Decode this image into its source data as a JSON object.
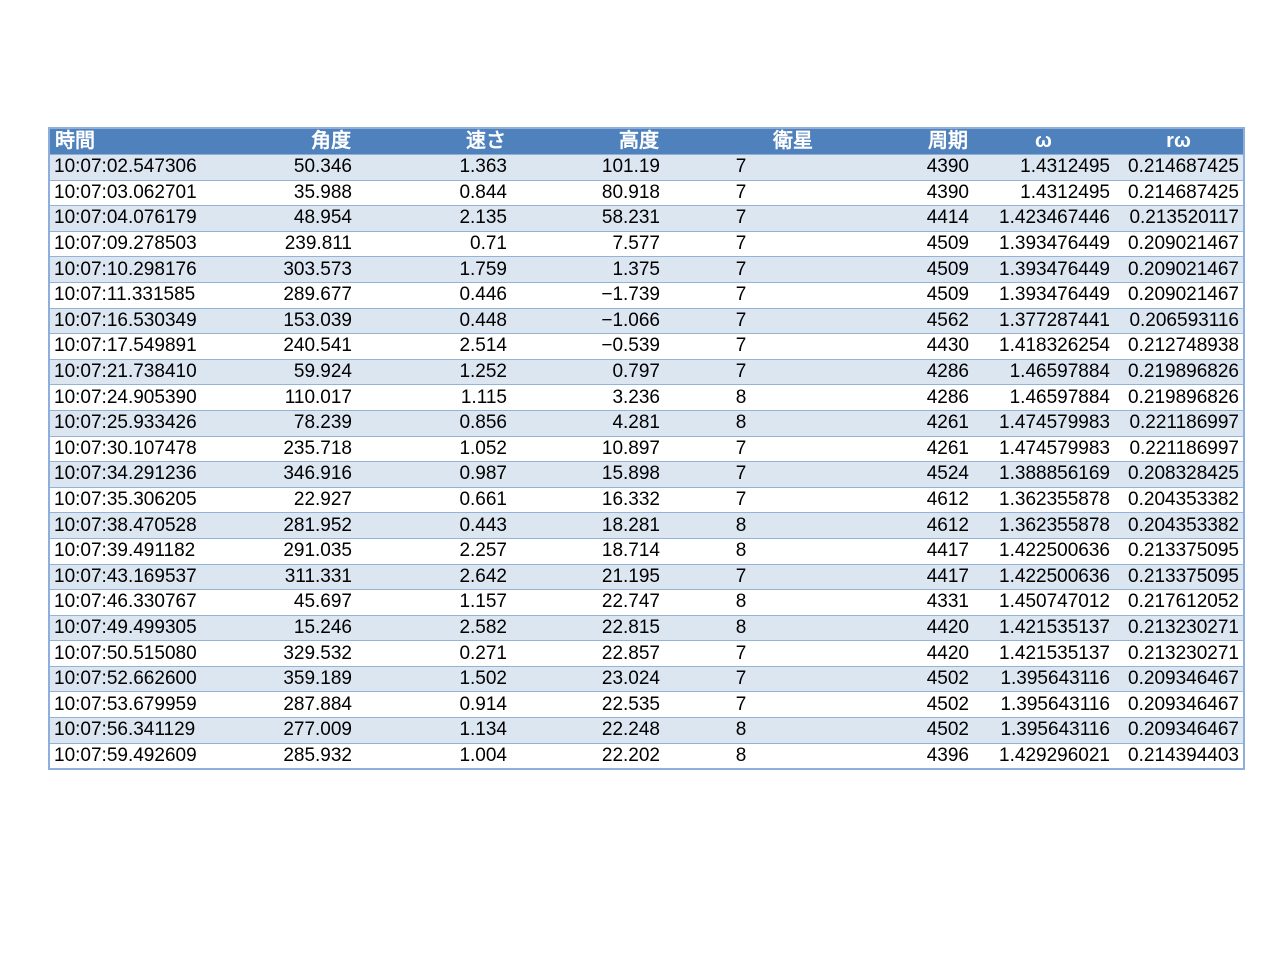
{
  "table": {
    "headers": [
      "時間",
      "角度",
      "速さ",
      "高度",
      "衛星",
      "周期",
      "ω",
      "rω"
    ],
    "rows": [
      [
        "10:07:02.547306",
        "50.346",
        "1.363",
        "101.19",
        "7",
        "4390",
        "1.4312495",
        "0.214687425"
      ],
      [
        "10:07:03.062701",
        "35.988",
        "0.844",
        "80.918",
        "7",
        "4390",
        "1.4312495",
        "0.214687425"
      ],
      [
        "10:07:04.076179",
        "48.954",
        "2.135",
        "58.231",
        "7",
        "4414",
        "1.423467446",
        "0.213520117"
      ],
      [
        "10:07:09.278503",
        "239.811",
        "0.71",
        "7.577",
        "7",
        "4509",
        "1.393476449",
        "0.209021467"
      ],
      [
        "10:07:10.298176",
        "303.573",
        "1.759",
        "1.375",
        "7",
        "4509",
        "1.393476449",
        "0.209021467"
      ],
      [
        "10:07:11.331585",
        "289.677",
        "0.446",
        "−1.739",
        "7",
        "4509",
        "1.393476449",
        "0.209021467"
      ],
      [
        "10:07:16.530349",
        "153.039",
        "0.448",
        "−1.066",
        "7",
        "4562",
        "1.377287441",
        "0.206593116"
      ],
      [
        "10:07:17.549891",
        "240.541",
        "2.514",
        "−0.539",
        "7",
        "4430",
        "1.418326254",
        "0.212748938"
      ],
      [
        "10:07:21.738410",
        "59.924",
        "1.252",
        "0.797",
        "7",
        "4286",
        "1.46597884",
        "0.219896826"
      ],
      [
        "10:07:24.905390",
        "110.017",
        "1.115",
        "3.236",
        "8",
        "4286",
        "1.46597884",
        "0.219896826"
      ],
      [
        "10:07:25.933426",
        "78.239",
        "0.856",
        "4.281",
        "8",
        "4261",
        "1.474579983",
        "0.221186997"
      ],
      [
        "10:07:30.107478",
        "235.718",
        "1.052",
        "10.897",
        "7",
        "4261",
        "1.474579983",
        "0.221186997"
      ],
      [
        "10:07:34.291236",
        "346.916",
        "0.987",
        "15.898",
        "7",
        "4524",
        "1.388856169",
        "0.208328425"
      ],
      [
        "10:07:35.306205",
        "22.927",
        "0.661",
        "16.332",
        "7",
        "4612",
        "1.362355878",
        "0.204353382"
      ],
      [
        "10:07:38.470528",
        "281.952",
        "0.443",
        "18.281",
        "8",
        "4612",
        "1.362355878",
        "0.204353382"
      ],
      [
        "10:07:39.491182",
        "291.035",
        "2.257",
        "18.714",
        "8",
        "4417",
        "1.422500636",
        "0.213375095"
      ],
      [
        "10:07:43.169537",
        "311.331",
        "2.642",
        "21.195",
        "7",
        "4417",
        "1.422500636",
        "0.213375095"
      ],
      [
        "10:07:46.330767",
        "45.697",
        "1.157",
        "22.747",
        "8",
        "4331",
        "1.450747012",
        "0.217612052"
      ],
      [
        "10:07:49.499305",
        "15.246",
        "2.582",
        "22.815",
        "8",
        "4420",
        "1.421535137",
        "0.213230271"
      ],
      [
        "10:07:50.515080",
        "329.532",
        "0.271",
        "22.857",
        "7",
        "4420",
        "1.421535137",
        "0.213230271"
      ],
      [
        "10:07:52.662600",
        "359.189",
        "1.502",
        "23.024",
        "7",
        "4502",
        "1.395643116",
        "0.209346467"
      ],
      [
        "10:07:53.679959",
        "287.884",
        "0.914",
        "22.535",
        "7",
        "4502",
        "1.395643116",
        "0.209346467"
      ],
      [
        "10:07:56.341129",
        "277.009",
        "1.134",
        "22.248",
        "8",
        "4502",
        "1.395643116",
        "0.209346467"
      ],
      [
        "10:07:59.492609",
        "285.932",
        "1.004",
        "22.202",
        "8",
        "4396",
        "1.429296021",
        "0.214394403"
      ]
    ]
  },
  "colors": {
    "header_bg": "#4f81bd",
    "header_text": "#ffffff",
    "band_row": "#dce6f1",
    "plain_row": "#ffffff",
    "border": "#8eaedb"
  }
}
